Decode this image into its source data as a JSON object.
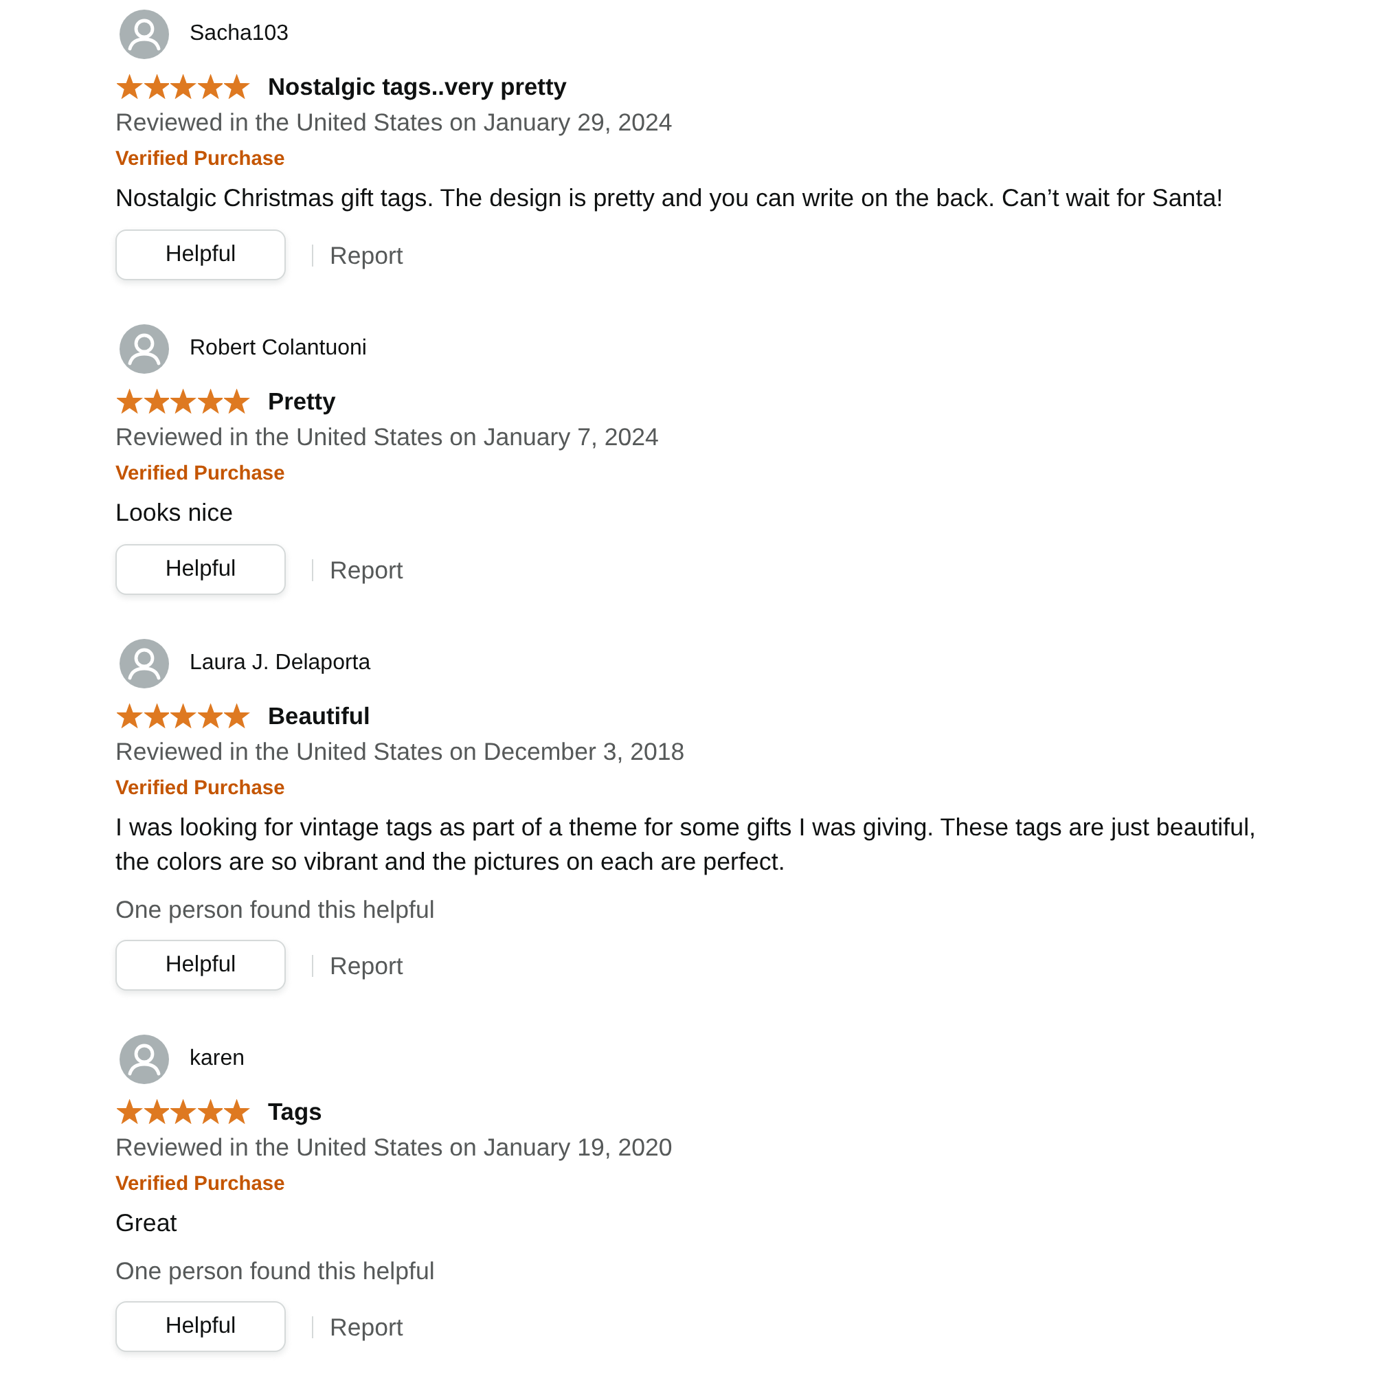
{
  "reviews": [
    {
      "name": "Sacha103",
      "stars": 5,
      "title": "Nostalgic tags..very pretty",
      "date": "Reviewed in the United States on January 29, 2024",
      "badge": "Verified Purchase",
      "body": "Nostalgic Christmas gift tags. The design is pretty and you can write on the back. Can’t wait for Santa!",
      "helpful_button": "Helpful",
      "report_link": "Report"
    },
    {
      "name": "Robert Colantuoni",
      "stars": 5,
      "title": "Pretty",
      "date": "Reviewed in the United States on January 7, 2024",
      "badge": "Verified Purchase",
      "body": "Looks nice",
      "helpful_button": "Helpful",
      "report_link": "Report"
    },
    {
      "name": "Laura J. Delaporta",
      "stars": 5,
      "title": "Beautiful",
      "date": "Reviewed in the United States on December 3, 2018",
      "badge": "Verified Purchase",
      "body": "I was looking for vintage tags as part of a theme for some gifts I was giving. These tags are just beautiful, the colors are so vibrant and the pictures on each are perfect.",
      "helpful_count": "One person found this helpful",
      "helpful_button": "Helpful",
      "report_link": "Report"
    },
    {
      "name": "karen",
      "stars": 5,
      "title": "Tags",
      "date": "Reviewed in the United States on January 19, 2020",
      "badge": "Verified Purchase",
      "body": "Great",
      "helpful_count": "One person found this helpful",
      "helpful_button": "Helpful",
      "report_link": "Report"
    }
  ]
}
